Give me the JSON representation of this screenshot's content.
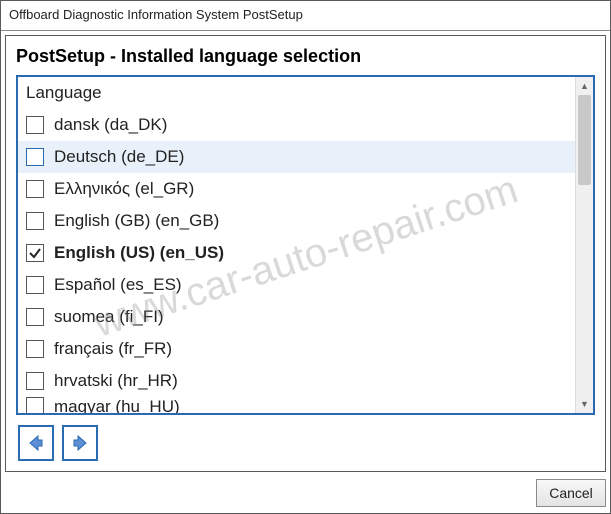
{
  "window": {
    "title": "Offboard Diagnostic Information System PostSetup"
  },
  "page": {
    "heading": "PostSetup - Installed language selection",
    "column_header": "Language",
    "languages": [
      {
        "label": "dansk  (da_DK)",
        "checked": false,
        "highlight": false
      },
      {
        "label": "Deutsch  (de_DE)",
        "checked": false,
        "highlight": true
      },
      {
        "label": "Ελληνικός  (el_GR)",
        "checked": false,
        "highlight": false
      },
      {
        "label": "English (GB)  (en_GB)",
        "checked": false,
        "highlight": false
      },
      {
        "label": "English (US)  (en_US)",
        "checked": true,
        "highlight": false
      },
      {
        "label": "Español  (es_ES)",
        "checked": false,
        "highlight": false
      },
      {
        "label": "suomea  (fi_FI)",
        "checked": false,
        "highlight": false
      },
      {
        "label": "français  (fr_FR)",
        "checked": false,
        "highlight": false
      },
      {
        "label": "hrvatski  (hr_HR)",
        "checked": false,
        "highlight": false
      },
      {
        "label": "magyar  (hu_HU)",
        "checked": false,
        "highlight": false,
        "cutoff": true
      }
    ]
  },
  "buttons": {
    "back": "Back",
    "next": "Next",
    "cancel": "Cancel"
  },
  "colors": {
    "accent": "#2a6ab0",
    "highlight_row": "#e8f1fa"
  },
  "watermark": "www.car-auto-repair.com"
}
